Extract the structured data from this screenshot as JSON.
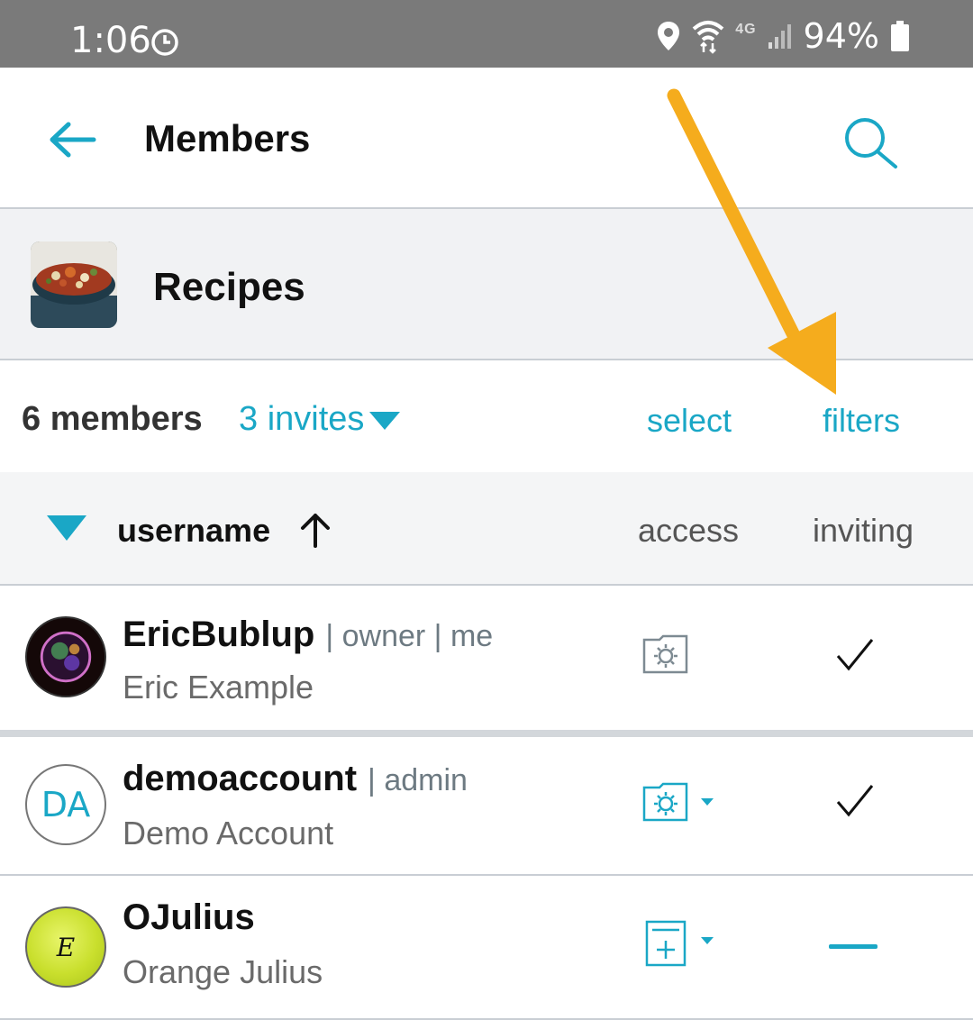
{
  "status_bar": {
    "time": "1:06",
    "network": "4G",
    "battery": "94%",
    "icons": [
      "alarm-clock-icon",
      "location-pin-icon",
      "wifi-icon",
      "signal-icon",
      "battery-icon"
    ]
  },
  "app_bar": {
    "title": "Members",
    "back_icon": "back-arrow-icon",
    "search_icon": "search-icon"
  },
  "group": {
    "name": "Recipes"
  },
  "summary": {
    "members_count": "6 members",
    "invites": "3 invites",
    "select": "select",
    "filters": "filters"
  },
  "columns": {
    "username": "username",
    "access": "access",
    "inviting": "inviting"
  },
  "members": [
    {
      "username": "EricBublup",
      "roles": "| owner | me",
      "full_name": "Eric Example",
      "avatar": "",
      "access_icon": "folder-gear-icon",
      "inviting": "check"
    },
    {
      "username": "demoaccount",
      "roles": "| admin",
      "full_name": "Demo Account",
      "avatar": "DA",
      "access_icon": "folder-gear-icon",
      "inviting": "check"
    },
    {
      "username": "OJulius",
      "roles": "",
      "full_name": "Orange Julius",
      "avatar": "E",
      "access_icon": "add-item-icon",
      "inviting": "none"
    }
  ],
  "colors": {
    "accent": "#1aa7c6",
    "status_bar": "#7a7a7a",
    "annotation_arrow": "#f5ac1d"
  }
}
